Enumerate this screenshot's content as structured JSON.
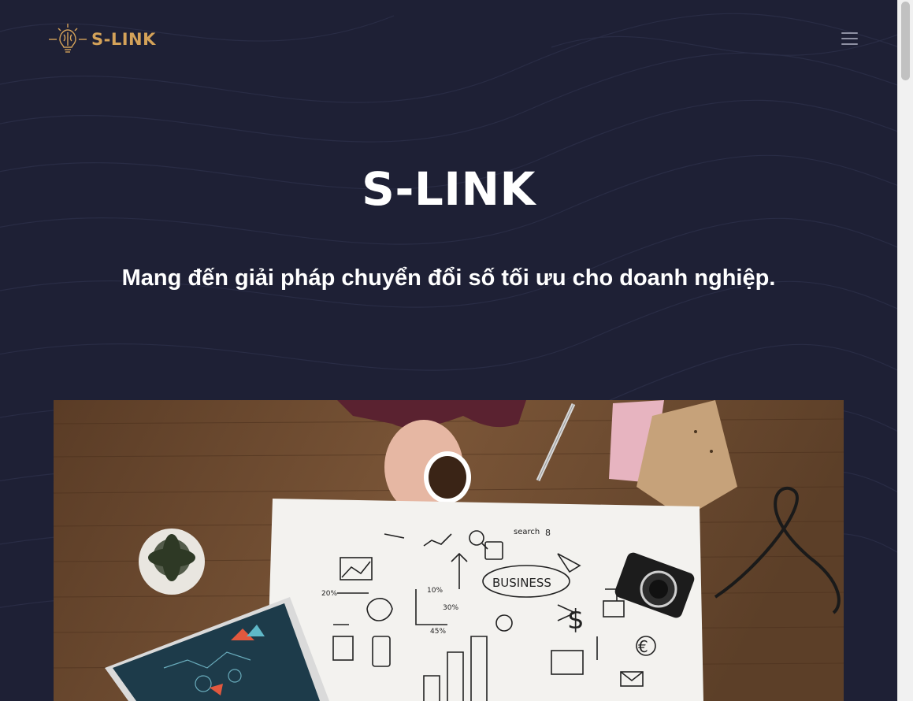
{
  "header": {
    "logo_text": "S-LINK",
    "menu_icon": "hamburger-menu-icon"
  },
  "hero": {
    "title": "S-LINK",
    "subtitle": "Mang đến giải pháp chuyển đổi số tối ưu cho doanh nghiệp."
  },
  "image": {
    "annotations": {
      "search_label": "search",
      "calendar_number": "8",
      "business_label": "BUSINESS",
      "percent_20": "20%",
      "percent_10": "10%",
      "percent_30": "30%",
      "percent_45": "45%"
    }
  },
  "colors": {
    "background": "#1e2035",
    "brand_gold": "#d4a259",
    "text": "#ffffff",
    "menu_icon": "#8e90a3",
    "wood": "#6b4a30"
  }
}
